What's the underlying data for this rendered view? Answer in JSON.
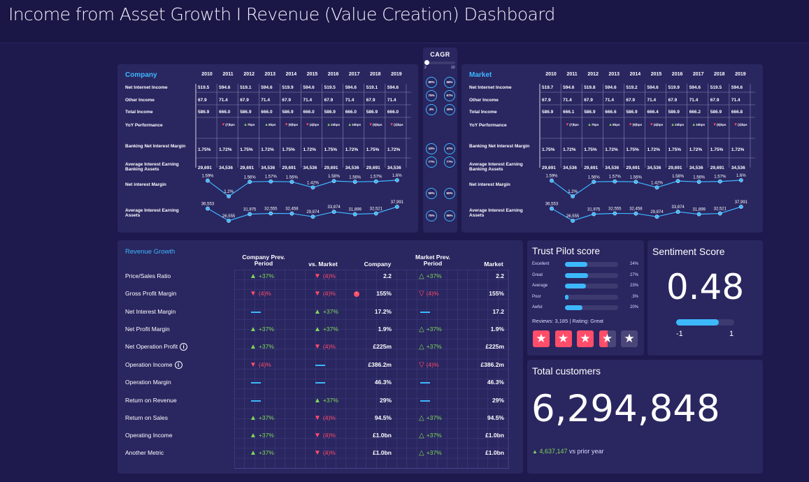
{
  "header": {
    "title": "Income from Asset Growth I Revenue (Value Creation) Dashboard"
  },
  "company": {
    "title": "Company",
    "years": [
      "2010",
      "2011",
      "2012",
      "2013",
      "2014",
      "2015",
      "2016",
      "2017",
      "2018",
      "2019"
    ],
    "rows": [
      {
        "label": "Net Internet Income",
        "values": [
          "519.5",
          "594.6",
          "519.1",
          "594.6",
          "519.9",
          "594.6",
          "519.5",
          "594.6",
          "519.1",
          "594.6"
        ]
      },
      {
        "label": "Other Income",
        "values": [
          "67.9",
          "71.4",
          "67.9",
          "71.4",
          "67.9",
          "71.4",
          "67.9",
          "71.4",
          "67.9",
          "71.4"
        ]
      },
      {
        "label": "Total Income",
        "values": [
          "586.9",
          "666.0",
          "586.9",
          "666.0",
          "586.9",
          "666.0",
          "586.9",
          "666.0",
          "586.9",
          "666.0"
        ]
      }
    ],
    "yoy_label": "YoY Performance",
    "yoy": [
      null,
      {
        "dir": "down",
        "text": "(7)bps"
      },
      {
        "dir": "up",
        "text": "7bps"
      },
      {
        "dir": "up",
        "text": "6bps"
      },
      {
        "dir": "down",
        "text": "(9)bps"
      },
      {
        "dir": "down",
        "text": "(4)bps"
      },
      {
        "dir": "up",
        "text": "24bps"
      },
      {
        "dir": "up",
        "text": "15bps"
      },
      {
        "dir": "down",
        "text": "(5)bps"
      },
      {
        "dir": "down",
        "text": "(2)bps"
      }
    ],
    "rows2": [
      {
        "label": "Banking Net Interest Margin",
        "values": [
          "1.75%",
          "1.72%",
          "1.75%",
          "1.72%",
          "1.75%",
          "1.72%",
          "1.75%",
          "1.72%",
          "1.75%",
          "1.72%"
        ]
      },
      {
        "label": "Average Interest Earning Banking Assets",
        "values": [
          "29,691",
          "34,536",
          "29,691",
          "34,536",
          "29,691",
          "34,536",
          "29,691",
          "34,536",
          "29,691",
          "34,536"
        ]
      }
    ],
    "nim_label": "Net interest Margin",
    "nim_points": [
      "1.59%",
      "1.2%",
      "1.56%",
      "1.57%",
      "1.56%",
      "1.42%",
      "1.58%",
      "1.56%",
      "1.57%",
      "1.6%"
    ],
    "nim_values": [
      1.59,
      1.2,
      1.56,
      1.57,
      1.56,
      1.42,
      1.58,
      1.56,
      1.57,
      1.6
    ],
    "aiea_label": "Average Interest Earning Assets",
    "aiea_points": [
      "36,553",
      "26,555",
      "31,975",
      "32,555",
      "32,458",
      "29,874",
      "33,874",
      "31,899",
      "32,521",
      "37,991"
    ],
    "aiea_values": [
      36553,
      26555,
      31975,
      32555,
      32458,
      29874,
      33874,
      31899,
      32521,
      37991
    ]
  },
  "market": {
    "title": "Market",
    "years": [
      "2010",
      "2011",
      "2012",
      "2013",
      "2014",
      "2015",
      "2016",
      "2017",
      "2018",
      "2019"
    ],
    "rows": [
      {
        "label": "Net Internet Income",
        "values": [
          "519.7",
          "594.6",
          "519.8",
          "594.6",
          "519.2",
          "594.6",
          "519.9",
          "594.6",
          "519.5",
          "594.6"
        ]
      },
      {
        "label": "Other Income",
        "values": [
          "67.9",
          "71.4",
          "67.9",
          "71.4",
          "67.9",
          "71.4",
          "67.9",
          "71.4",
          "67.9",
          "71.4"
        ]
      },
      {
        "label": "Total Income",
        "values": [
          "586.9",
          "666.1",
          "586.9",
          "666.6",
          "586.9",
          "666.4",
          "586.9",
          "666.2",
          "586.9",
          "666.8"
        ]
      }
    ],
    "yoy_label": "YoY Performance",
    "yoy": [
      null,
      {
        "dir": "down",
        "text": "(7)bps"
      },
      {
        "dir": "up",
        "text": "7bps"
      },
      {
        "dir": "up",
        "text": "6bps"
      },
      {
        "dir": "down",
        "text": "(9)bps"
      },
      {
        "dir": "down",
        "text": "(4)bps"
      },
      {
        "dir": "up",
        "text": "24bps"
      },
      {
        "dir": "up",
        "text": "15bps"
      },
      {
        "dir": "down",
        "text": "(5)bps"
      },
      {
        "dir": "down",
        "text": "(2)bps"
      }
    ],
    "rows2": [
      {
        "label": "Banking Net Interest Margin",
        "values": [
          "1.75%",
          "1.72%",
          "1.75%",
          "1.72%",
          "1.75%",
          "1.72%",
          "1.75%",
          "1.72%",
          "1.75%",
          "1.72%"
        ]
      },
      {
        "label": "Average Interest Earning Banking Assets",
        "values": [
          "29,691",
          "34,536",
          "29,691",
          "34,536",
          "29,691",
          "34,536",
          "29,691",
          "34,536",
          "29,691",
          "34,536"
        ]
      }
    ],
    "nim_label": "Net interest Margin",
    "nim_points": [
      "1.59%",
      "1.2%",
      "1.56%",
      "1.57%",
      "1.56%",
      "1.42%",
      "1.58%",
      "1.56%",
      "1.57%",
      "1.6%"
    ],
    "nim_values": [
      1.59,
      1.2,
      1.56,
      1.57,
      1.56,
      1.42,
      1.58,
      1.56,
      1.57,
      1.6
    ],
    "aiea_label": "Average Interest Earning Assets",
    "aiea_points": [
      "36,553",
      "26,555",
      "31,975",
      "32,555",
      "32,458",
      "29,874",
      "33,874",
      "31,899",
      "32,521",
      "37,991"
    ],
    "aiea_values": [
      36553,
      26555,
      31975,
      32555,
      32458,
      29874,
      33874,
      31899,
      32521,
      37991
    ]
  },
  "cagr": {
    "title": "CAGR",
    "slider_min": "2",
    "slider_max": "10",
    "slider_value": 2,
    "circles": [
      [
        "80%",
        "58%"
      ],
      [
        "75%",
        "67%"
      ],
      [
        "4%",
        "40%"
      ],
      [
        "43%",
        "47%"
      ],
      [
        "77%",
        "77%"
      ],
      [
        "50%",
        "60%"
      ],
      [
        "75%",
        "56%"
      ]
    ]
  },
  "revenue_growth": {
    "title": "Revenue Growth",
    "headers": [
      "Company Prev. Period",
      "vs. Market",
      "Company",
      "Market Prev. Period",
      "Market"
    ],
    "rows": [
      {
        "label": "Price/Sales Ratio",
        "info": false,
        "cpp": {
          "dir": "up",
          "text": "+37%"
        },
        "vsm": {
          "dir": "down",
          "text": "(4)%"
        },
        "company": "2.2",
        "mpp": {
          "dir": "up-outline",
          "text": "+37%"
        },
        "market": "2.2"
      },
      {
        "label": "Gross Profit Margin",
        "info": false,
        "cpp": {
          "dir": "down",
          "text": "(4)%"
        },
        "vsm": {
          "dir": "down",
          "text": "(4)%"
        },
        "company": "155%",
        "mpp": {
          "dir": "down-outline",
          "text": "(4)%"
        },
        "market": "155%"
      },
      {
        "label": "Net Interest Margin",
        "info": false,
        "cpp": {
          "dir": "flat",
          "text": ""
        },
        "vsm": {
          "dir": "up",
          "text": "+37%"
        },
        "company": "17.2%",
        "mpp": {
          "dir": "flat",
          "text": ""
        },
        "market": "17.2"
      },
      {
        "label": "Net Profit Margin",
        "info": false,
        "cpp": {
          "dir": "up",
          "text": "+37%"
        },
        "vsm": {
          "dir": "up",
          "text": "+37%"
        },
        "company": "1.9%",
        "mpp": {
          "dir": "up-outline",
          "text": "+37%"
        },
        "market": "1.9%"
      },
      {
        "label": "Net Operation Profit",
        "info": true,
        "cpp": {
          "dir": "up",
          "text": "+37%"
        },
        "vsm": {
          "dir": "down",
          "text": "(4)%"
        },
        "company": "£225m",
        "mpp": {
          "dir": "up-outline",
          "text": "+37%"
        },
        "market": "£225m"
      },
      {
        "label": "Operation Income",
        "info": true,
        "cpp": {
          "dir": "down",
          "text": "(4)%"
        },
        "vsm": {
          "dir": "flat",
          "text": ""
        },
        "company": "£386.2m",
        "mpp": {
          "dir": "down-outline",
          "text": "(4)%"
        },
        "market": "£386.2m"
      },
      {
        "label": "Operation Margin",
        "info": false,
        "cpp": {
          "dir": "flat",
          "text": ""
        },
        "vsm": {
          "dir": "flat",
          "text": ""
        },
        "company": "46.3%",
        "mpp": {
          "dir": "flat",
          "text": ""
        },
        "market": "46.3%"
      },
      {
        "label": "Return on Revenue",
        "info": false,
        "cpp": {
          "dir": "flat",
          "text": ""
        },
        "vsm": {
          "dir": "up",
          "text": "+37%"
        },
        "company": "29%",
        "mpp": {
          "dir": "flat",
          "text": ""
        },
        "market": "29%"
      },
      {
        "label": "Return on Sales",
        "info": false,
        "cpp": {
          "dir": "up",
          "text": "+37%"
        },
        "vsm": {
          "dir": "down",
          "text": "(4)%"
        },
        "company": "94.5%",
        "mpp": {
          "dir": "up-outline",
          "text": "+37%"
        },
        "market": "94.5%"
      },
      {
        "label": "Operating Income",
        "info": false,
        "cpp": {
          "dir": "up",
          "text": "+37%"
        },
        "vsm": {
          "dir": "down",
          "text": "(4)%"
        },
        "company": "£1.0bn",
        "mpp": {
          "dir": "up-outline",
          "text": "+37%"
        },
        "market": "£1.0bn"
      },
      {
        "label": "Another Metric",
        "info": false,
        "cpp": {
          "dir": "up",
          "text": "+37%"
        },
        "vsm": {
          "dir": "down",
          "text": "(4)%"
        },
        "company": "£1.0bn",
        "mpp": {
          "dir": "up-outline",
          "text": "+37%"
        },
        "market": "£1.0bn"
      }
    ]
  },
  "trust_pilot": {
    "title": "Trust Pilot score",
    "rows": [
      {
        "label": "Excellent",
        "pct": "24%",
        "fill": 0.42
      },
      {
        "label": "Great",
        "pct": "27%",
        "fill": 0.44
      },
      {
        "label": "Average",
        "pct": "23%",
        "fill": 0.4
      },
      {
        "label": "Poor",
        "pct": ".3%",
        "fill": 0.07
      },
      {
        "label": "Awful",
        "pct": "20%",
        "fill": 0.33
      }
    ],
    "reviews_text": "Reviews: 3,185 | Rating: Great",
    "stars_filled": 3.5,
    "stars_total": 5,
    "star_color": "#ff4d6a"
  },
  "sentiment": {
    "title": "Sentiment Score",
    "value": "0.48",
    "min_label": "-1",
    "max_label": "1",
    "fill": 0.74
  },
  "customers": {
    "title": "Total customers",
    "value": "6,294,848",
    "delta": "4,637,147",
    "delta_suffix": "vs prior year"
  },
  "colors": {
    "accent": "#3db8ff",
    "up": "#7ed957",
    "down": "#ff4d6a",
    "panel": "#2a2660",
    "background": "#1e1a4d"
  }
}
